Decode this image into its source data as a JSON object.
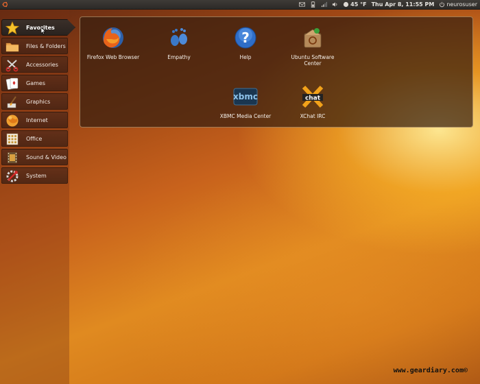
{
  "top_panel": {
    "datetime": "Thu Apr  8, 11:55 PM",
    "weather": "45 °F",
    "username": "neurosuser"
  },
  "sidebar": {
    "items": [
      {
        "label": "Favorites",
        "icon": "star-icon",
        "active": true
      },
      {
        "label": "Files & Folders",
        "icon": "folder-icon"
      },
      {
        "label": "Accessories",
        "icon": "scissors-icon"
      },
      {
        "label": "Games",
        "icon": "playing-cards-icon"
      },
      {
        "label": "Graphics",
        "icon": "paintbrush-icon"
      },
      {
        "label": "Internet",
        "icon": "globe-icon"
      },
      {
        "label": "Office",
        "icon": "calculator-icon"
      },
      {
        "label": "Sound & Video",
        "icon": "film-icon"
      },
      {
        "label": "System",
        "icon": "wrench-icon"
      }
    ]
  },
  "favorites": {
    "apps": [
      {
        "label": "Firefox Web Browser",
        "icon": "firefox-icon"
      },
      {
        "label": "Empathy",
        "icon": "empathy-icon"
      },
      {
        "label": "Help",
        "icon": "help-icon"
      },
      {
        "label": "Ubuntu Software Center",
        "icon": "software-center-icon"
      },
      {
        "label": "XBMC Media Center",
        "icon": "xbmc-icon"
      },
      {
        "label": "XChat IRC",
        "icon": "xchat-icon"
      }
    ]
  },
  "watermark": "www.geardiary.com©",
  "colors": {
    "panel_bg": "#2c2a27",
    "accent_orange": "#e08a20",
    "favorites_bg": "#371e0f"
  }
}
